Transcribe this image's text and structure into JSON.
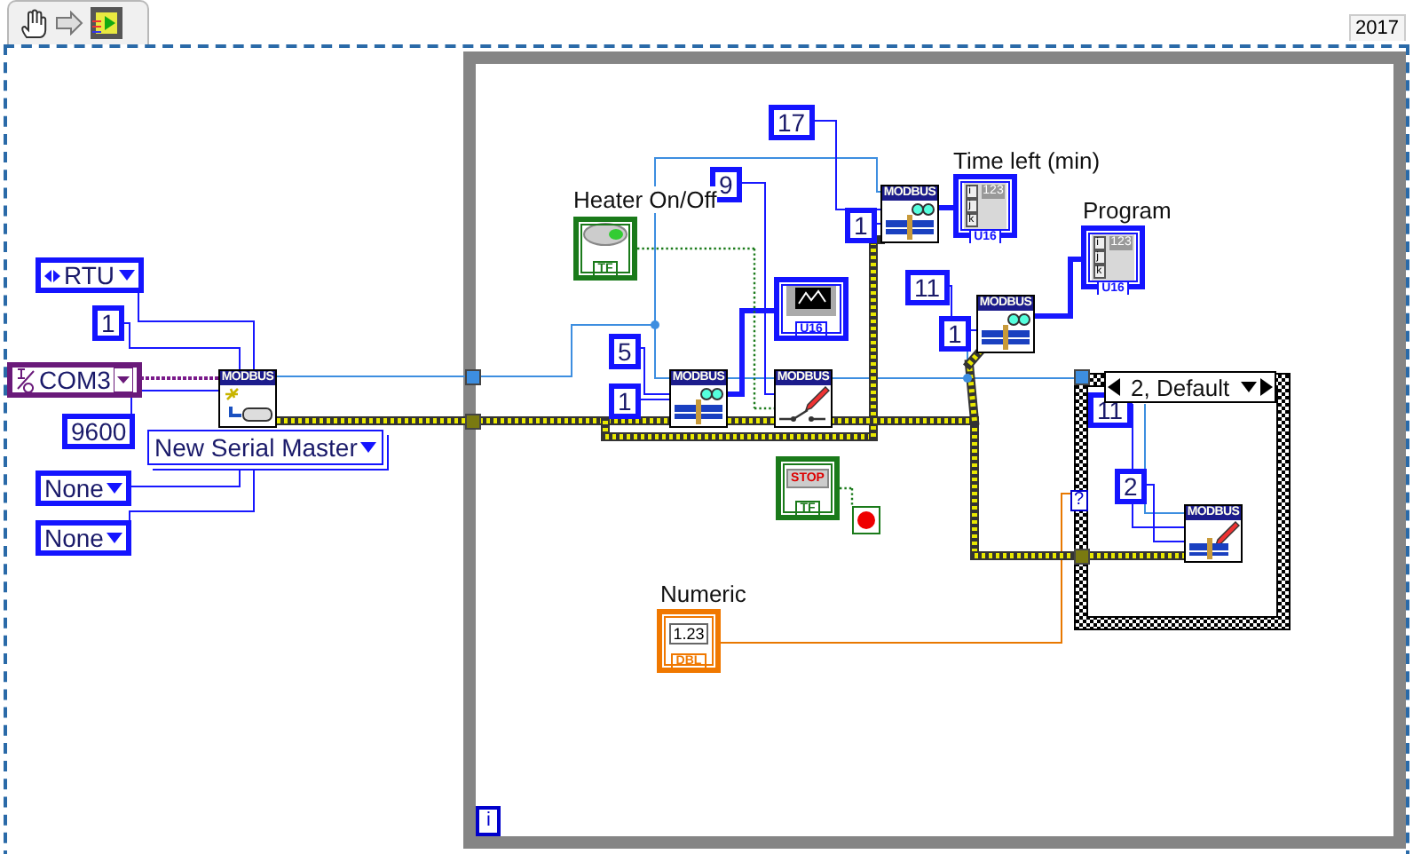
{
  "toolbar": {
    "year": "2017"
  },
  "constants": [
    {
      "kind": "enum",
      "text": "RTU"
    },
    {
      "kind": "number",
      "text": "1"
    },
    {
      "kind": "visa",
      "text": "COM3"
    },
    {
      "kind": "number",
      "text": "9600"
    },
    {
      "kind": "ring",
      "text": "New Serial Master"
    },
    {
      "kind": "enum",
      "text": "None"
    },
    {
      "kind": "enum",
      "text": "None"
    },
    {
      "kind": "number",
      "text": "5"
    },
    {
      "kind": "number",
      "text": "1"
    },
    {
      "kind": "number",
      "text": "9"
    },
    {
      "kind": "number",
      "text": "17"
    },
    {
      "kind": "number",
      "text": "1"
    },
    {
      "kind": "number",
      "text": "11"
    },
    {
      "kind": "number",
      "text": "1"
    },
    {
      "kind": "number",
      "text": "11"
    },
    {
      "kind": "number",
      "text": "2"
    }
  ],
  "subvis": [
    {
      "kind": "open",
      "header": "MODBUS"
    },
    {
      "kind": "read",
      "header": "MODBUS"
    },
    {
      "kind": "write-bool",
      "header": "MODBUS"
    },
    {
      "kind": "read",
      "header": "MODBUS"
    },
    {
      "kind": "read",
      "header": "MODBUS"
    },
    {
      "kind": "write",
      "header": "MODBUS"
    }
  ],
  "terminals": [
    {
      "kind": "boolean",
      "label": "Heater On/Off",
      "type": "TF"
    },
    {
      "kind": "stop",
      "value": "STOP",
      "type": "TF"
    },
    {
      "kind": "numeric",
      "label": "Numeric",
      "value": "1.23",
      "type": "DBL"
    },
    {
      "kind": "chart",
      "type": "U16"
    },
    {
      "kind": "array",
      "label": "Time left (min)",
      "value": "123",
      "type": "U16",
      "indices": [
        "i",
        "j",
        "k"
      ]
    },
    {
      "kind": "array",
      "label": "Program",
      "value": "123",
      "type": "U16",
      "indices": [
        "i",
        "j",
        "k"
      ]
    }
  ],
  "case_structure": {
    "selector": "2, Default",
    "selector_terminal": "?"
  },
  "while_loop": {
    "iteration": "i"
  }
}
